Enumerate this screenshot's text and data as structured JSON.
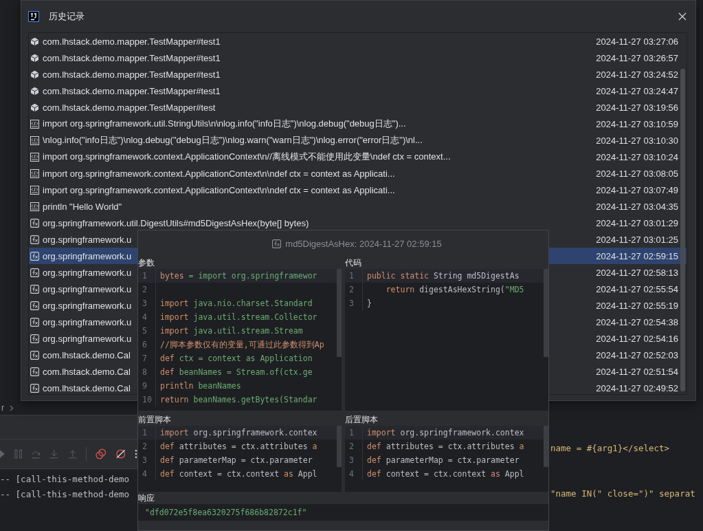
{
  "dialog": {
    "title": "历史记录",
    "rows": [
      {
        "kind": "package",
        "text": "com.lhstack.demo.mapper.TestMapper#test1",
        "time": "2024-11-27 03:27:06",
        "selected": false
      },
      {
        "kind": "package",
        "text": "com.lhstack.demo.mapper.TestMapper#test1",
        "time": "2024-11-27 03:26:57",
        "selected": false
      },
      {
        "kind": "package",
        "text": "com.lhstack.demo.mapper.TestMapper#test1",
        "time": "2024-11-27 03:24:52",
        "selected": false
      },
      {
        "kind": "package",
        "text": "com.lhstack.demo.mapper.TestMapper#test1",
        "time": "2024-11-27 03:24:47",
        "selected": false
      },
      {
        "kind": "package",
        "text": "com.lhstack.demo.mapper.TestMapper#test",
        "time": "2024-11-27 03:19:56",
        "selected": false
      },
      {
        "kind": "script",
        "text": "import org.springframework.util.StringUtils\\n\\nlog.info(\"info日志\")\\nlog.debug(\"debug日志\")...",
        "time": "2024-11-27 03:10:59",
        "selected": false
      },
      {
        "kind": "script",
        "text": "\\nlog.info(\"info日志\")\\nlog.debug(\"debug日志\")\\nlog.warn(\"warn日志\")\\nlog.error(\"error日志\")\\nl...",
        "time": "2024-11-27 03:10:30",
        "selected": false
      },
      {
        "kind": "script",
        "text": "import org.springframework.context.ApplicationContext\\n//离线模式不能使用此变量\\ndef ctx = context...",
        "time": "2024-11-27 03:10:24",
        "selected": false
      },
      {
        "kind": "script",
        "text": "import org.springframework.context.ApplicationContext\\n\\ndef ctx = context as Applicati...",
        "time": "2024-11-27 03:08:05",
        "selected": false
      },
      {
        "kind": "script",
        "text": "import org.springframework.context.ApplicationContext\\n\\ndef ctx = context as Applicati...",
        "time": "2024-11-27 03:07:49",
        "selected": false
      },
      {
        "kind": "script",
        "text": "println \"Hello World\"",
        "time": "2024-11-27 03:04:35",
        "selected": false
      },
      {
        "kind": "function",
        "text": "org.springframework.util.DigestUtils#md5DigestAsHex(byte[] bytes)",
        "time": "2024-11-27 03:01:29",
        "selected": false
      },
      {
        "kind": "function",
        "text": "org.springframework.u",
        "time": "2024-11-27 03:01:25",
        "selected": false
      },
      {
        "kind": "function",
        "text": "org.springframework.u",
        "time": "2024-11-27 02:59:15",
        "selected": true
      },
      {
        "kind": "function",
        "text": "org.springframework.u",
        "time": "2024-11-27 02:58:13",
        "selected": false
      },
      {
        "kind": "function",
        "text": "org.springframework.u",
        "time": "2024-11-27 02:55:54",
        "selected": false
      },
      {
        "kind": "function",
        "text": "org.springframework.u",
        "time": "2024-11-27 02:55:19",
        "selected": false
      },
      {
        "kind": "function",
        "text": "org.springframework.u",
        "time": "2024-11-27 02:54:38",
        "selected": false
      },
      {
        "kind": "function",
        "text": "org.springframework.u",
        "time": "2024-11-27 02:54:16",
        "selected": false
      },
      {
        "kind": "function",
        "text": "com.lhstack.demo.Cal",
        "time": "2024-11-27 02:52:03",
        "selected": false
      },
      {
        "kind": "function",
        "text": "com.lhstack.demo.Cal",
        "time": "2024-11-27 02:51:54",
        "selected": false
      },
      {
        "kind": "function",
        "text": "com.lhstack.demo.Cal",
        "time": "2024-11-27 02:49:52",
        "selected": false
      }
    ]
  },
  "preview": {
    "title": "md5DigestAsHex: 2024-11-27 02:59:15",
    "panels": [
      {
        "label": "参数",
        "lines": [
          {
            "no": "1",
            "segments": [
              {
                "text": "bytes",
                "kind": "keyword"
              },
              {
                "text": " = import org.springframewor",
                "kind": "string"
              }
            ]
          },
          {
            "no": "2"
          },
          {
            "no": "3",
            "segments": [
              {
                "text": "import",
                "kind": "keyword"
              },
              {
                "text": " java.nio.charset.Standard",
                "kind": "string"
              }
            ]
          },
          {
            "no": "4",
            "segments": [
              {
                "text": "import",
                "kind": "keyword"
              },
              {
                "text": " java.util.stream.Collector",
                "kind": "string"
              }
            ]
          },
          {
            "no": "5",
            "segments": [
              {
                "text": "import",
                "kind": "keyword"
              },
              {
                "text": " java.util.stream.Stream",
                "kind": "string"
              }
            ]
          },
          {
            "no": "6",
            "segments": [
              {
                "text": "//脚本参数仅有的变量,可通过此参数得到Ap",
                "kind": "keyword"
              }
            ]
          },
          {
            "no": "7",
            "segments": [
              {
                "text": "def",
                "kind": "keyword"
              },
              {
                "text": " ctx = context as Application",
                "kind": "string"
              }
            ]
          },
          {
            "no": "8",
            "segments": [
              {
                "text": "def",
                "kind": "keyword"
              },
              {
                "text": " beanNames = Stream.of(ctx.ge",
                "kind": "string"
              }
            ]
          },
          {
            "no": "9",
            "segments": [
              {
                "text": "println",
                "kind": "keyword"
              },
              {
                "text": " beanNames",
                "kind": "string"
              }
            ]
          },
          {
            "no": "10",
            "segments": [
              {
                "text": "return",
                "kind": "keyword"
              },
              {
                "text": " beanNames.getBytes(Standar",
                "kind": "string"
              }
            ]
          }
        ]
      },
      {
        "label": "代码",
        "lines": [
          {
            "no": "1",
            "segments": [
              {
                "text": "public static",
                "kind": "keyword"
              },
              {
                "text": " String md5DigestAs",
                "kind": "plain"
              }
            ]
          },
          {
            "no": "2",
            "segments": [
              {
                "text": "    return",
                "kind": "keyword"
              },
              {
                "text": " digestAsHexString(",
                "kind": "plain"
              },
              {
                "text": "\"MD5",
                "kind": "string"
              }
            ]
          },
          {
            "no": "3",
            "segments": [
              {
                "text": "}",
                "kind": "plain"
              }
            ]
          }
        ]
      },
      {
        "label": "前置脚本",
        "lines": [
          {
            "no": "1",
            "segments": [
              {
                "text": "import",
                "kind": "keyword"
              },
              {
                "text": " org.springframework.contex",
                "kind": "plain"
              }
            ]
          },
          {
            "no": "2",
            "segments": [
              {
                "text": "def",
                "kind": "keyword"
              },
              {
                "text": " attributes = ctx.attributes ",
                "kind": "plain"
              },
              {
                "text": "a",
                "kind": "keyword"
              }
            ]
          },
          {
            "no": "3",
            "segments": [
              {
                "text": "def",
                "kind": "keyword"
              },
              {
                "text": " parameterMap = ctx.parameter",
                "kind": "plain"
              }
            ]
          },
          {
            "no": "4",
            "segments": [
              {
                "text": "def",
                "kind": "keyword"
              },
              {
                "text": " context = ctx.context ",
                "kind": "plain"
              },
              {
                "text": "as",
                "kind": "keyword"
              },
              {
                "text": " Appl",
                "kind": "plain"
              }
            ]
          }
        ]
      },
      {
        "label": "后置脚本",
        "lines": [
          {
            "no": "1",
            "segments": [
              {
                "text": "import",
                "kind": "keyword"
              },
              {
                "text": " org.springframework.contex",
                "kind": "plain"
              }
            ]
          },
          {
            "no": "2",
            "segments": [
              {
                "text": "def",
                "kind": "keyword"
              },
              {
                "text": " attributes = ctx.attributes ",
                "kind": "plain"
              },
              {
                "text": "a",
                "kind": "keyword"
              }
            ]
          },
          {
            "no": "3",
            "segments": [
              {
                "text": "def",
                "kind": "keyword"
              },
              {
                "text": " parameterMap = ctx.parameter",
                "kind": "plain"
              }
            ]
          },
          {
            "no": "4",
            "segments": [
              {
                "text": "def",
                "kind": "keyword"
              },
              {
                "text": " context = ctx.context ",
                "kind": "plain"
              },
              {
                "text": "as",
                "kind": "keyword"
              },
              {
                "text": " Appl",
                "kind": "plain"
              }
            ]
          }
        ]
      }
    ],
    "response": {
      "label": "响应",
      "value": "\"dfd072e5f8ea6320275f686b82872c1f\""
    }
  },
  "ide": {
    "breadcrumb": "r",
    "console": [
      "-- [call-this-method-demo",
      "-- [call-this-method-demo"
    ],
    "code": [
      "name = #{arg1}</select>",
      "\"name IN(\" close=\")\" separat"
    ]
  }
}
